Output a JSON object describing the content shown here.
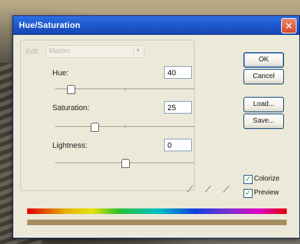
{
  "window": {
    "title": "Hue/Saturation"
  },
  "edit": {
    "label": "Edit:",
    "value": "Master"
  },
  "params": {
    "hue": {
      "label": "Hue:",
      "value": "40",
      "slider": 0.11
    },
    "saturation": {
      "label": "Saturation:",
      "value": "25",
      "slider": 0.28
    },
    "lightness": {
      "label": "Lightness:",
      "value": "0",
      "slider": 0.5
    }
  },
  "buttons": {
    "ok": "OK",
    "cancel": "Cancel",
    "load": "Load...",
    "save": "Save..."
  },
  "options": {
    "colorize": {
      "label": "Colorize",
      "checked": true
    },
    "preview": {
      "label": "Preview",
      "checked": true
    }
  },
  "colors": {
    "tone_bar": "#a58e5e",
    "title_bar": "#1f5bd0"
  }
}
